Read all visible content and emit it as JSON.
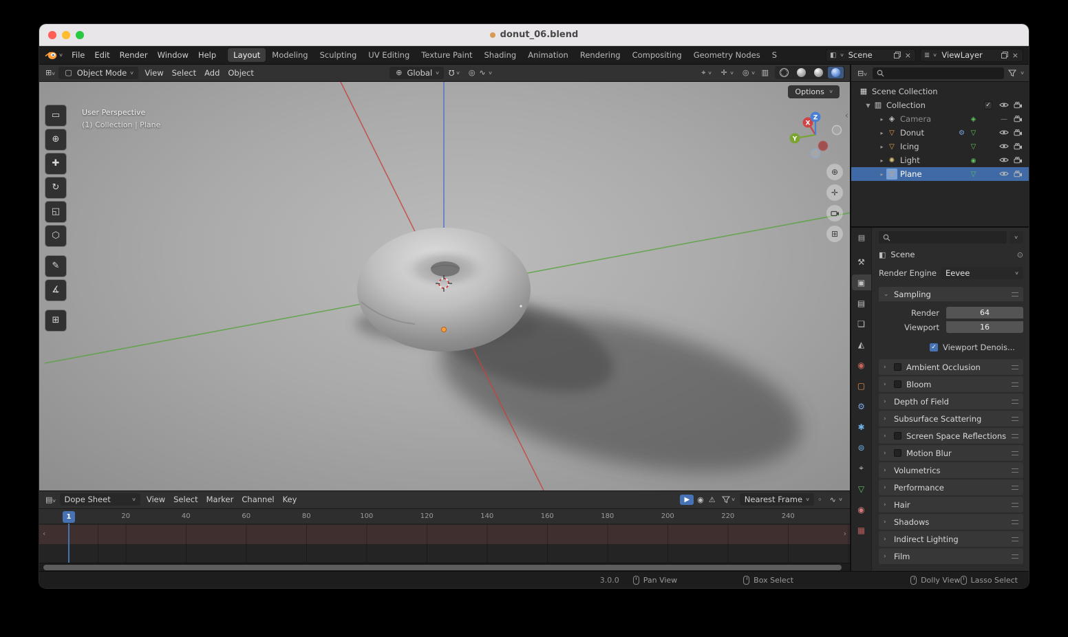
{
  "titlebar": {
    "title": "donut_06.blend"
  },
  "topbar": {
    "menus": [
      "File",
      "Edit",
      "Render",
      "Window",
      "Help"
    ],
    "workspaces": [
      {
        "label": "Layout",
        "active": true
      },
      {
        "label": "Modeling"
      },
      {
        "label": "Sculpting"
      },
      {
        "label": "UV Editing"
      },
      {
        "label": "Texture Paint"
      },
      {
        "label": "Shading"
      },
      {
        "label": "Animation"
      },
      {
        "label": "Rendering"
      },
      {
        "label": "Compositing"
      },
      {
        "label": "Geometry Nodes"
      },
      {
        "label": "S"
      }
    ],
    "scene_name": "Scene",
    "viewlayer_name": "ViewLayer"
  },
  "viewport_header": {
    "mode": "Object Mode",
    "menus": [
      "View",
      "Select",
      "Add",
      "Object"
    ],
    "orientation": "Global"
  },
  "viewport": {
    "overlay_line1": "User Perspective",
    "overlay_line2": "(1) Collection | Plane",
    "options_label": "Options",
    "gizmo": {
      "x": "X",
      "y": "Y",
      "z": "Z"
    },
    "tools": [
      "select-box",
      "cursor",
      "move",
      "rotate",
      "scale",
      "transform",
      "annotate",
      "measure",
      "add-cube"
    ]
  },
  "outliner": {
    "root": "Scene Collection",
    "items": [
      {
        "label": "Collection",
        "icon": "collection",
        "expander": "▼",
        "level": "lvl1",
        "check": true
      },
      {
        "label": "Camera",
        "icon": "camera",
        "expander": "▸",
        "level": "lvl2",
        "dim": true,
        "extra2": "camera-data",
        "eyeclosed": true
      },
      {
        "label": "Donut",
        "icon": "mesh",
        "expander": "▸",
        "level": "lvl2",
        "extra1": "modifier",
        "extra2": "mesh-data"
      },
      {
        "label": "Icing",
        "icon": "mesh",
        "expander": "▸",
        "level": "lvl2",
        "extra2": "mesh-data"
      },
      {
        "label": "Light",
        "icon": "light",
        "expander": "▸",
        "level": "lvl2",
        "extra2": "light-data"
      },
      {
        "label": "Plane",
        "icon": "mesh",
        "expander": "▸",
        "level": "lvl2",
        "extra2": "mesh-data",
        "selected": true
      }
    ]
  },
  "properties": {
    "breadcrumb": "Scene",
    "render_engine_label": "Render Engine",
    "render_engine_value": "Eevee",
    "tabs": [
      {
        "name": "tool"
      },
      {
        "name": "render",
        "active": true
      },
      {
        "name": "output"
      },
      {
        "name": "view-layer"
      },
      {
        "name": "scene"
      },
      {
        "name": "world"
      },
      {
        "name": "object"
      },
      {
        "name": "modifiers"
      },
      {
        "name": "particles"
      },
      {
        "name": "physics"
      },
      {
        "name": "constraints"
      },
      {
        "name": "data"
      },
      {
        "name": "material"
      },
      {
        "name": "texture"
      }
    ],
    "sampling": {
      "title": "Sampling",
      "rows": [
        {
          "label": "Render",
          "value": "64"
        },
        {
          "label": "Viewport",
          "value": "16"
        }
      ],
      "denoise_label": "Viewport Denois..."
    },
    "sections": [
      {
        "label": "Ambient Occlusion",
        "checkbox": true
      },
      {
        "label": "Bloom",
        "checkbox": true
      },
      {
        "label": "Depth of Field"
      },
      {
        "label": "Subsurface Scattering"
      },
      {
        "label": "Screen Space Reflections",
        "checkbox": true
      },
      {
        "label": "Motion Blur",
        "checkbox": true
      },
      {
        "label": "Volumetrics"
      },
      {
        "label": "Performance"
      },
      {
        "label": "Hair"
      },
      {
        "label": "Shadows"
      },
      {
        "label": "Indirect Lighting"
      },
      {
        "label": "Film"
      }
    ]
  },
  "timeline": {
    "editor_label": "Dope Sheet",
    "menus": [
      "View",
      "Select",
      "Marker",
      "Channel",
      "Key"
    ],
    "snap_label": "Nearest Frame",
    "current_frame": "1",
    "ticks": [
      "20",
      "40",
      "60",
      "80",
      "100",
      "120",
      "140",
      "160",
      "180",
      "200",
      "220",
      "240"
    ]
  },
  "statusbar": {
    "hints": [
      "Pan View",
      "Box Select",
      "Dolly View",
      "Lasso Select"
    ],
    "version": "3.0.0"
  }
}
